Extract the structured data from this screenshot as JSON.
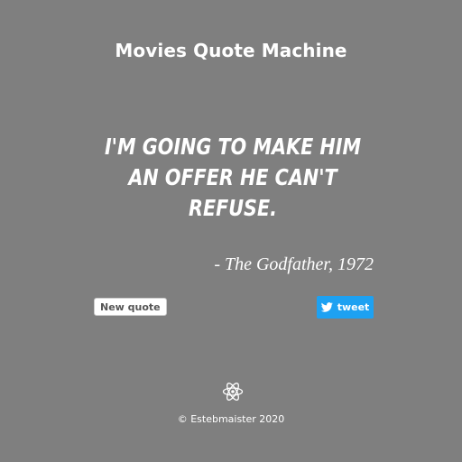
{
  "app": {
    "title": "Movies Quote Machine"
  },
  "quote": {
    "text": "I'm going to make him an offer he can't refuse.",
    "author": "- The Godfather, 1972"
  },
  "buttons": {
    "new_quote_label": "New quote",
    "tweet_label": "tweet"
  },
  "footer": {
    "text": "© Estebmaister 2020"
  },
  "icons": {
    "tweet": "twitter-bird-icon",
    "footer": "react-atom-icon"
  },
  "colors": {
    "background": "#7f7f7f",
    "text": "#ffffff",
    "tweet_button": "#1da1f2"
  }
}
